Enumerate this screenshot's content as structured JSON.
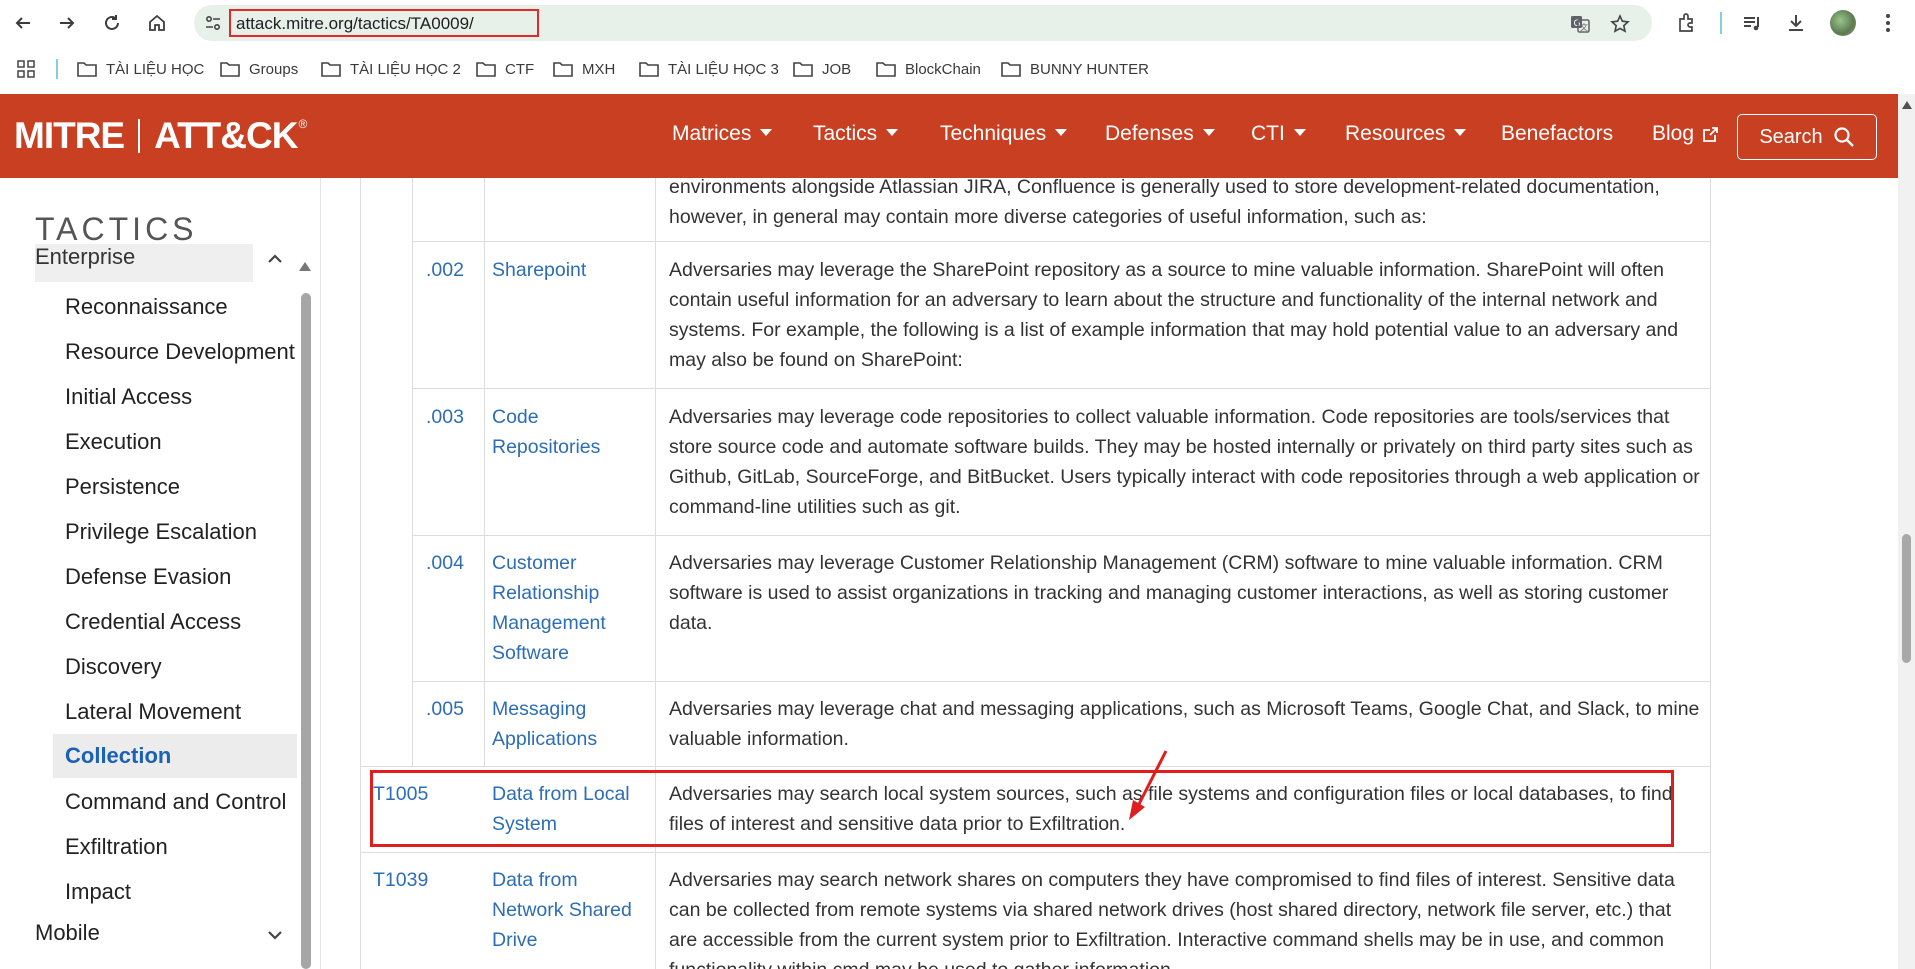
{
  "browser": {
    "url": "attack.mitre.org/tactics/TA0009/",
    "bookmarks": [
      "TÀI LIỆU HỌC",
      "Groups",
      "TÀI LIỆU HỌC 2",
      "CTF",
      "MXH",
      "TÀI LIỆU HỌC 3",
      "JOB",
      "BlockChain",
      "BUNNY HUNTER"
    ]
  },
  "header": {
    "logo_left": "MITRE",
    "logo_right": "ATT&CK",
    "logo_reg": "®",
    "nav": [
      "Matrices",
      "Tactics",
      "Techniques",
      "Defenses",
      "CTI",
      "Resources",
      "Benefactors",
      "Blog"
    ],
    "search_label": "Search"
  },
  "sidebar": {
    "title": "TACTICS",
    "group": "Enterprise",
    "items": [
      "Reconnaissance",
      "Resource Development",
      "Initial Access",
      "Execution",
      "Persistence",
      "Privilege Escalation",
      "Defense Evasion",
      "Credential Access",
      "Discovery",
      "Lateral Movement",
      "Collection",
      "Command and Control",
      "Exfiltration",
      "Impact"
    ],
    "active": "Collection",
    "group2": "Mobile"
  },
  "table": {
    "rows": [
      {
        "id": "",
        "name": "",
        "desc": "environments alongside Atlassian JIRA, Confluence is generally used to store development-related documentation, however, in general may contain more diverse categories of useful information, such as:"
      },
      {
        "id": ".002",
        "name": "Sharepoint",
        "desc": "Adversaries may leverage the SharePoint repository as a source to mine valuable information. SharePoint will often contain useful information for an adversary to learn about the structure and functionality of the internal network and systems. For example, the following is a list of example information that may hold potential value to an adversary and may also be found on SharePoint:"
      },
      {
        "id": ".003",
        "name": "Code Repositories",
        "desc": "Adversaries may leverage code repositories to collect valuable information. Code repositories are tools/services that store source code and automate software builds. They may be hosted internally or privately on third party sites such as Github, GitLab, SourceForge, and BitBucket. Users typically interact with code repositories through a web application or command-line utilities such as git."
      },
      {
        "id": ".004",
        "name": "Customer Relationship Management Software",
        "desc": "Adversaries may leverage Customer Relationship Management (CRM) software to mine valuable information. CRM software is used to assist organizations in tracking and managing customer interactions, as well as storing customer data."
      },
      {
        "id": ".005",
        "name": "Messaging Applications",
        "desc": "Adversaries may leverage chat and messaging applications, such as Microsoft Teams, Google Chat, and Slack, to mine valuable information."
      },
      {
        "id": "T1005",
        "name": "Data from Local System",
        "desc": "Adversaries may search local system sources, such as file systems and configuration files or local databases, to find files of interest and sensitive data prior to Exfiltration."
      },
      {
        "id": "T1039",
        "name": "Data from Network Shared Drive",
        "desc": "Adversaries may search network shares on computers they have compromised to find files of interest. Sensitive data can be collected from remote systems via shared network drives (host shared directory, network file server, etc.) that are accessible from the current system prior to Exfiltration. Interactive command shells may be in use, and common functionality within cmd may be used to gather information."
      }
    ]
  }
}
